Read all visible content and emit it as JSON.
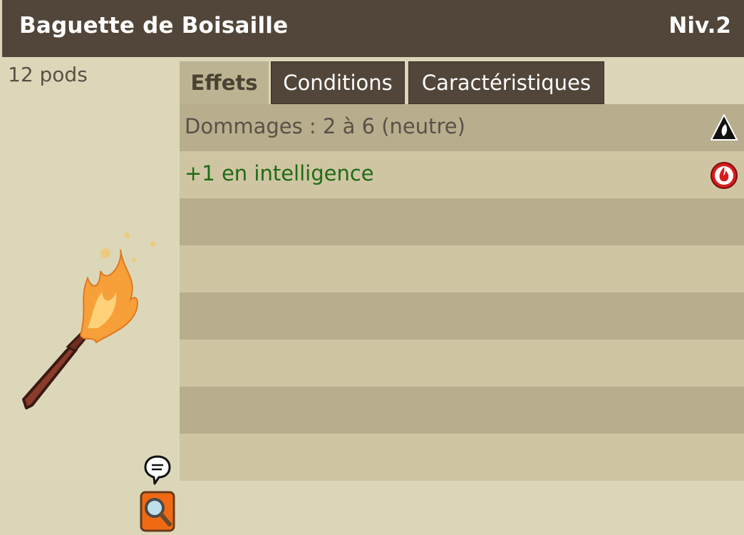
{
  "item": {
    "name": "Baguette de Boisaille",
    "level": "Niv.2",
    "weight": "12 pods"
  },
  "tabs": [
    {
      "label": "Effets",
      "active": true
    },
    {
      "label": "Conditions",
      "active": false
    },
    {
      "label": "Caractéristiques",
      "active": false
    }
  ],
  "effects": [
    {
      "text": "Dommages : 2 à 6 (neutre)",
      "icon": "neutral-element-icon",
      "color": "#5a5146"
    },
    {
      "text": "+1 en intelligence",
      "icon": "fire-element-icon",
      "color": "#1f6b14"
    }
  ],
  "colors": {
    "titlebar": "#514639",
    "panel": "#dcd6b8",
    "row_dark": "#b8ae8e",
    "row_light": "#cfc5a3",
    "bonus_text": "#1f6b14"
  }
}
